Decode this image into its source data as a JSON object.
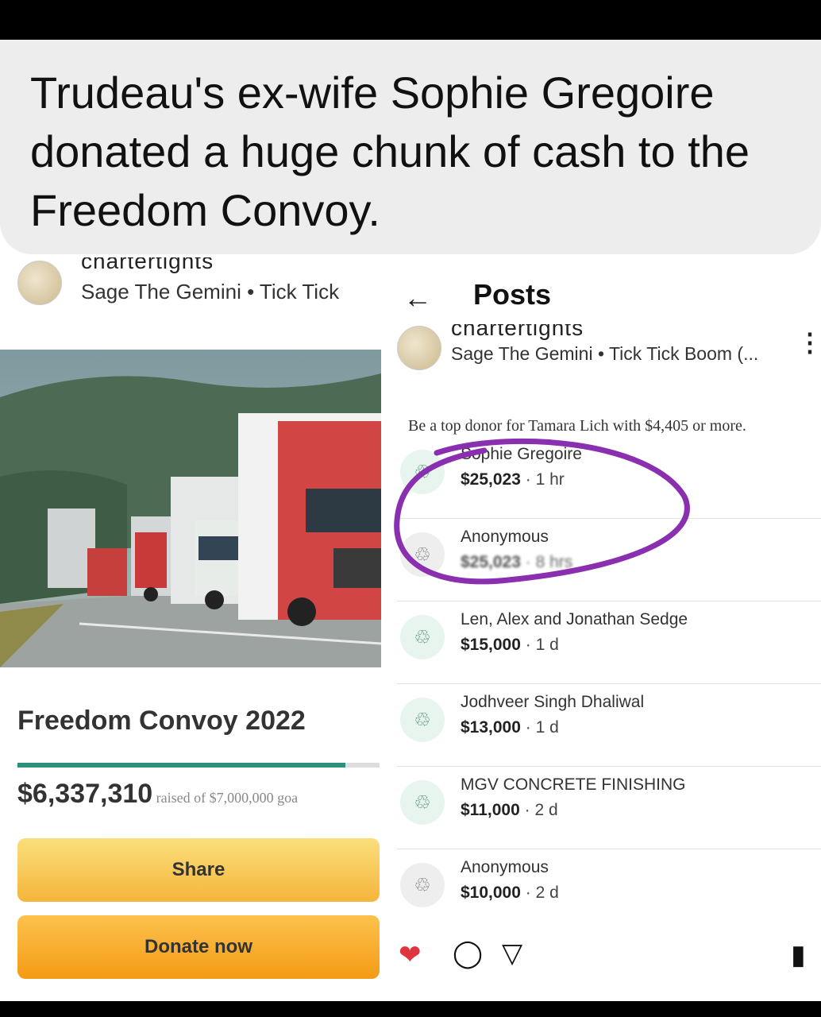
{
  "caption": "Trudeau's ex-wife Sophie Gregoire donated a huge chunk of cash to the Freedom Convoy.",
  "left_panel": {
    "account_name_cut": "chartertights",
    "account_sub": "Sage The Gemini • Tick Tick",
    "campaign_title": "Freedom Convoy 2022",
    "raised_amount": "$6,337,310",
    "raised_goal_text": "raised of $7,000,000 goa",
    "progress_fraction": 0.905,
    "share_label": "Share",
    "donate_label": "Donate now"
  },
  "right_panel": {
    "back_icon": "back-arrow-icon",
    "title": "Posts",
    "account_name_cut": "chartertights",
    "account_sub": "Sage The Gemini • Tick Tick Boom (...",
    "top_donor_text": "Be a top donor for Tamara Lich with $4,405 or more.",
    "donations": [
      {
        "name": "Sophie Gregoire",
        "amount": "$25,023",
        "time": "1 hr"
      },
      {
        "name": "Anonymous",
        "amount": "$25,023",
        "time": "8 hrs"
      },
      {
        "name": "Len, Alex and Jonathan Sedge",
        "amount": "$15,000",
        "time": "1 d"
      },
      {
        "name": "Jodhveer Singh Dhaliwal",
        "amount": "$13,000",
        "time": "1 d"
      },
      {
        "name": "MGV CONCRETE FINISHING",
        "amount": "$11,000",
        "time": "2 d"
      },
      {
        "name": "Anonymous",
        "amount": "$10,000",
        "time": "2 d"
      },
      {
        "name": "Anonymous",
        "amount": "",
        "time": ""
      }
    ]
  },
  "colors": {
    "progress_green": "#2c8f7b",
    "share_yellow": "#f5b53b",
    "donate_orange": "#f49b16",
    "annotation_purple": "#8a2fb0",
    "heart_red": "#e0343f"
  }
}
